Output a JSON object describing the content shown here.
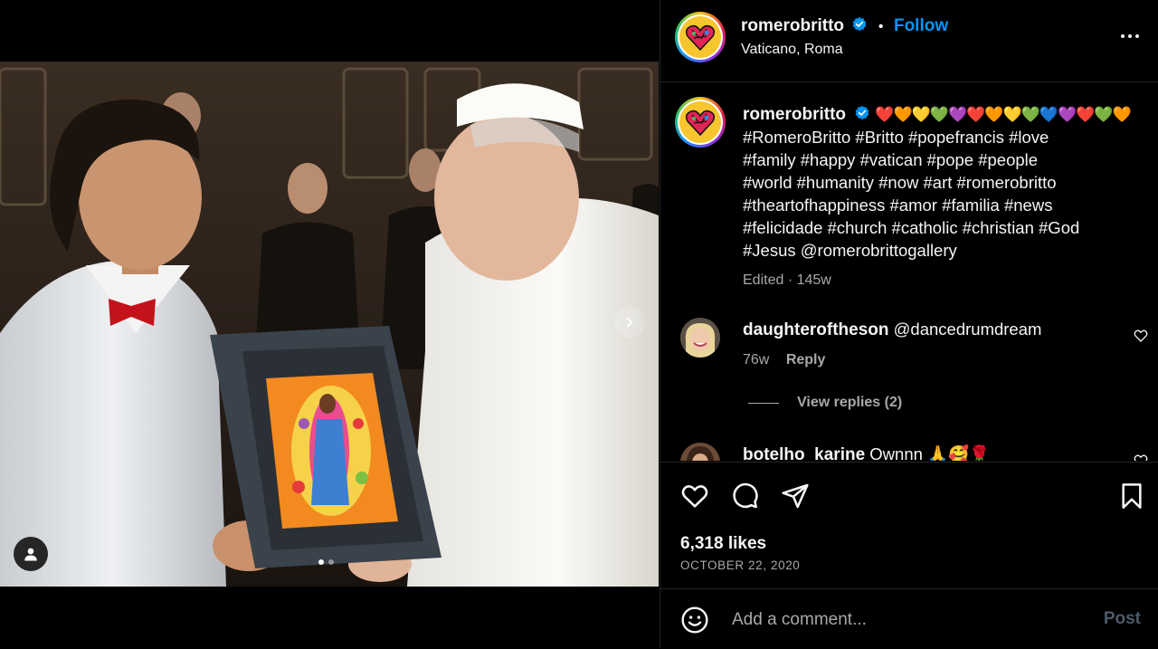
{
  "post": {
    "username": "romerobritto",
    "location": "Vaticano, Roma",
    "follow_label": "Follow",
    "separator": "•",
    "caption_hearts": "❤️🧡💛💚💜❤️🧡💛💚💙💜❤️💚🧡",
    "caption_lines": [
      "#RomeroBritto #Britto #popefrancis #love",
      "#family #happy #vatican #pope #people",
      "#world #humanity #now #art #romerobritto",
      "#theartofhappiness #amor #familia #news",
      "#felicidade #church #catholic #christian #God",
      "#Jesus @romerobrittogallery"
    ],
    "caption_meta": "Edited · 145w",
    "likes": "6,318 likes",
    "date": "OCTOBER 22, 2020"
  },
  "comments": [
    {
      "username": "daughteroftheson",
      "text": "@dancedrumdream",
      "age": "76w",
      "reply_label": "Reply",
      "view_replies": "View replies (2)"
    },
    {
      "username": "botelho_karine",
      "text": "Ownnn 🙏🥰🌹"
    }
  ],
  "add_comment": {
    "placeholder": "Add a comment...",
    "post_label": "Post"
  },
  "colors": {
    "accent": "#0095f6",
    "background": "#000000",
    "secondary_text": "#a8a8a8",
    "border": "#262626"
  },
  "icons": {
    "more": "more-options-icon",
    "like": "heart-icon",
    "comment": "comment-bubble-icon",
    "share": "paper-plane-icon",
    "save": "bookmark-icon",
    "emoji": "emoji-smile-icon",
    "tag": "user-tag-icon",
    "next": "chevron-right-icon"
  },
  "carousel": {
    "slides": 2,
    "current": 1
  }
}
